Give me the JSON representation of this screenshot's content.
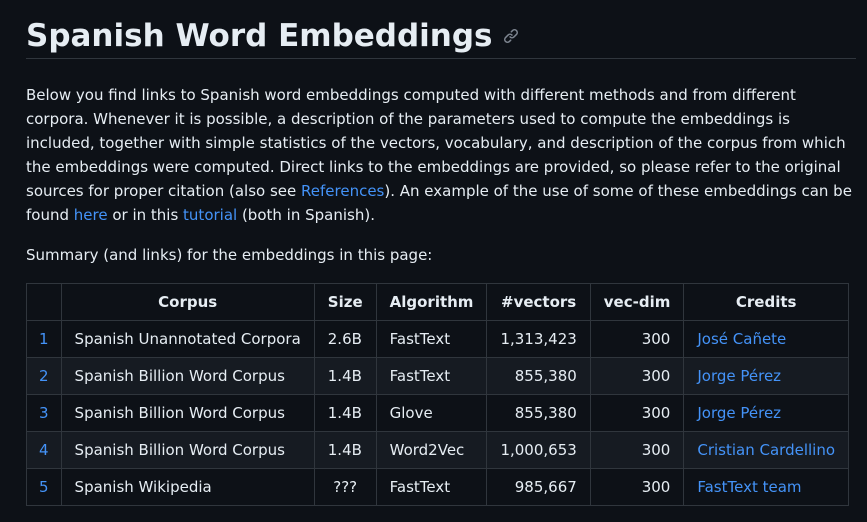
{
  "title": "Spanish Word Embeddings",
  "intro": {
    "part1": "Below you find links to Spanish word embeddings computed with different methods and from different corpora. Whenever it is possible, a description of the parameters used to compute the embeddings is included, together with simple statistics of the vectors, vocabulary, and description of the corpus from which the embeddings were computed. Direct links to the embeddings are provided, so please refer to the original sources for proper citation (also see ",
    "link_references": "References",
    "part2": "). An example of the use of some of these embeddings can be found ",
    "link_here": "here",
    "part3": " or in this ",
    "link_tutorial": "tutorial",
    "part4": " (both in Spanish)."
  },
  "summary": "Summary (and links) for the embeddings in this page:",
  "table": {
    "headers": [
      "",
      "Corpus",
      "Size",
      "Algorithm",
      "#vectors",
      "vec-dim",
      "Credits"
    ],
    "rows": [
      {
        "num": "1",
        "corpus": "Spanish Unannotated Corpora",
        "size": "2.6B",
        "algorithm": "FastText",
        "vectors": "1,313,423",
        "dim": "300",
        "credits": "José Cañete"
      },
      {
        "num": "2",
        "corpus": "Spanish Billion Word Corpus",
        "size": "1.4B",
        "algorithm": "FastText",
        "vectors": "855,380",
        "dim": "300",
        "credits": "Jorge Pérez"
      },
      {
        "num": "3",
        "corpus": "Spanish Billion Word Corpus",
        "size": "1.4B",
        "algorithm": "Glove",
        "vectors": "855,380",
        "dim": "300",
        "credits": "Jorge Pérez"
      },
      {
        "num": "4",
        "corpus": "Spanish Billion Word Corpus",
        "size": "1.4B",
        "algorithm": "Word2Vec",
        "vectors": "1,000,653",
        "dim": "300",
        "credits": "Cristian Cardellino"
      },
      {
        "num": "5",
        "corpus": "Spanish Wikipedia",
        "size": "???",
        "algorithm": "FastText",
        "vectors": "985,667",
        "dim": "300",
        "credits": "FastText team"
      }
    ]
  },
  "colors": {
    "background": "#0d1117",
    "text": "#e6edf3",
    "link": "#4493f8",
    "border": "#30363d",
    "row_alt": "#161b22"
  },
  "icons": {
    "heading_anchor": "link-icon"
  }
}
